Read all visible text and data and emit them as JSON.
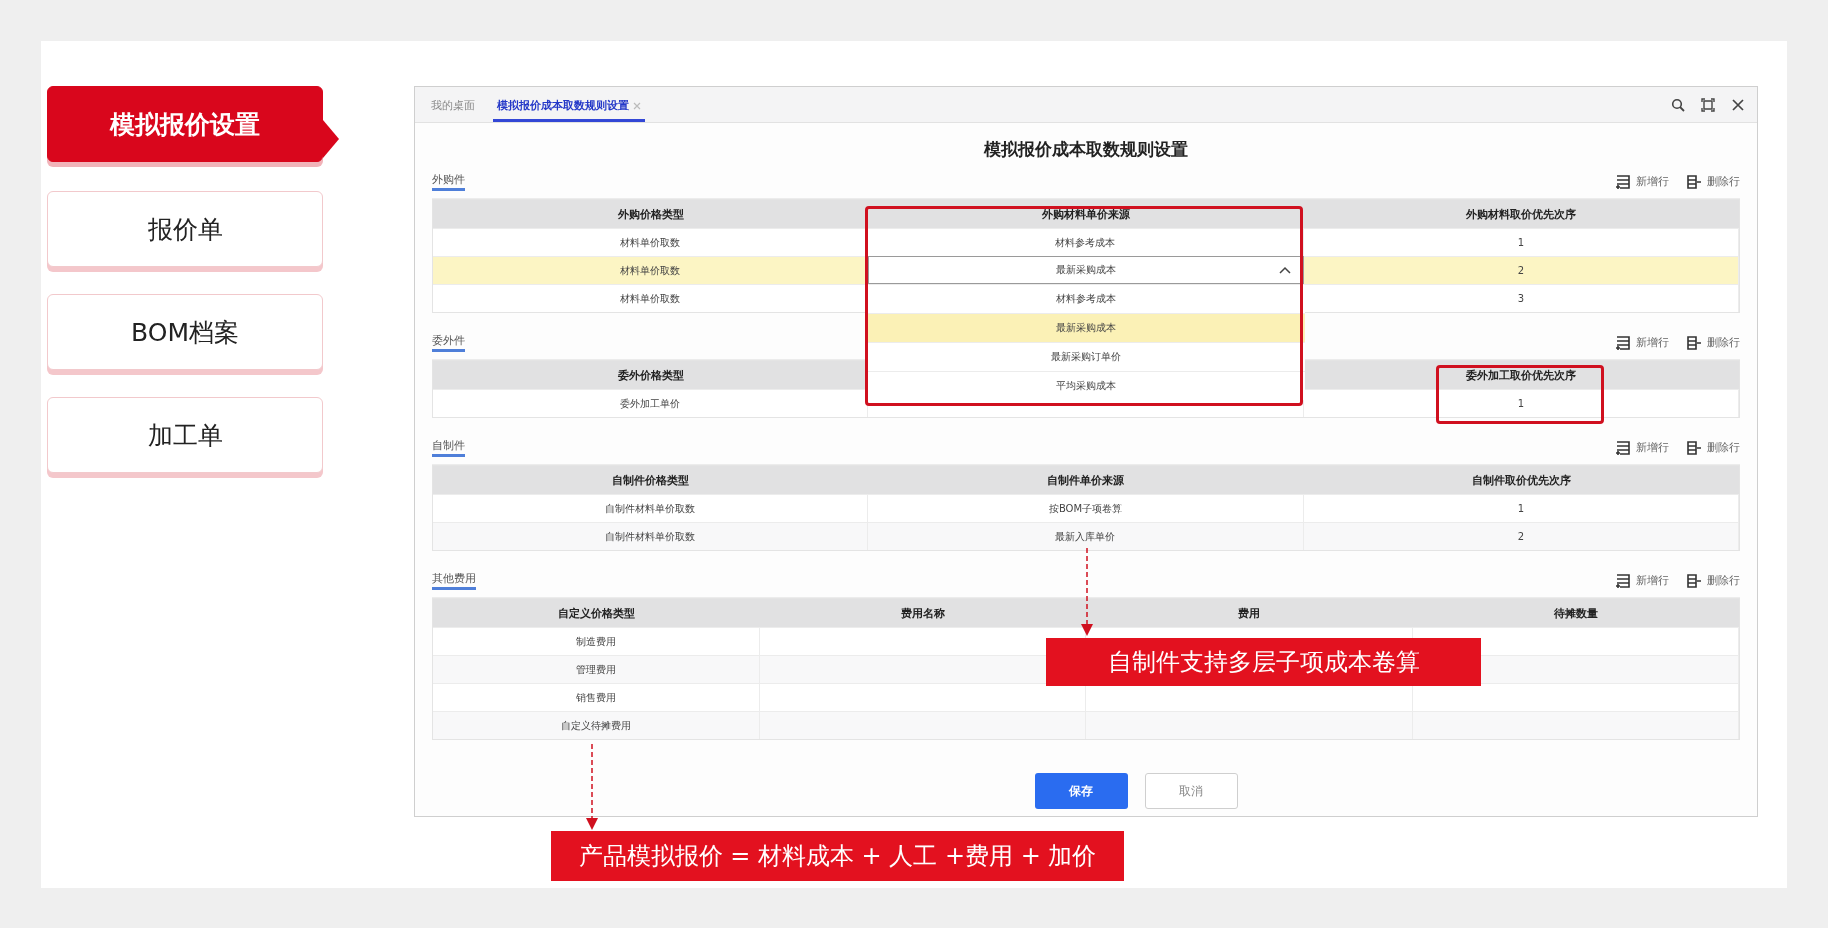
{
  "nav": [
    {
      "label": "模拟报价设置",
      "selected": true
    },
    {
      "label": "报价单",
      "selected": false
    },
    {
      "label": "BOM档案",
      "selected": false
    },
    {
      "label": "加工单",
      "selected": false
    }
  ],
  "window": {
    "tabs": [
      {
        "label": "我的桌面",
        "selected": false,
        "closable": false
      },
      {
        "label": "模拟报价成本取数规则设置",
        "selected": true,
        "closable": true
      }
    ],
    "title": "模拟报价成本取数规则设置",
    "sections": [
      {
        "name": "外购件",
        "actions": [
          {
            "label": "新增行",
            "kind": "add"
          },
          {
            "label": "删除行",
            "kind": "delete"
          }
        ],
        "columns": [
          "外购价格类型",
          "外购材料单价来源",
          "外购材料取价优先次序"
        ],
        "rows": [
          {
            "selected": false,
            "cells": [
              "材料单价取数",
              "材料参考成本",
              "1"
            ]
          },
          {
            "selected": true,
            "cells": [
              "材料单价取数",
              {
                "value": "最新采购成本",
                "open": true,
                "options": [
                  {
                    "label": "材料参考成本",
                    "selected": false
                  },
                  {
                    "label": "最新采购成本",
                    "selected": true
                  },
                  {
                    "label": "最新采购订单价",
                    "selected": false
                  },
                  {
                    "label": "平均采购成本",
                    "selected": false
                  }
                ]
              },
              "2"
            ]
          },
          {
            "selected": false,
            "cells": [
              "材料单价取数",
              null,
              "3"
            ]
          }
        ]
      },
      {
        "name": "委外件",
        "actions": [
          {
            "label": "新增行",
            "kind": "add"
          },
          {
            "label": "删除行",
            "kind": "delete"
          }
        ],
        "columns": [
          "委外价格类型",
          null,
          "委外加工取价优先次序"
        ],
        "rows": [
          {
            "selected": false,
            "cells": [
              "委外加工单价",
              null,
              "1"
            ]
          }
        ]
      },
      {
        "name": "自制件",
        "actions": [
          {
            "label": "新增行",
            "kind": "add"
          },
          {
            "label": "删除行",
            "kind": "delete"
          }
        ],
        "columns": [
          "自制件价格类型",
          "自制件单价来源",
          "自制件取价优先次序"
        ],
        "rows": [
          {
            "selected": false,
            "cells": [
              "自制件材料单价取数",
              "按BOM子项卷算",
              "1"
            ]
          },
          {
            "selected": false,
            "cells": [
              "自制件材料单价取数",
              "最新入库单价",
              "2"
            ]
          }
        ]
      },
      {
        "name": "其他费用",
        "actions": [
          {
            "label": "新增行",
            "kind": "add"
          },
          {
            "label": "删除行",
            "kind": "delete"
          }
        ],
        "columns": [
          "自定义价格类型",
          "费用名称",
          "费用",
          "待摊数量"
        ],
        "rows": [
          {
            "selected": false,
            "cells": [
              "制造费用",
              null,
              null,
              null
            ]
          },
          {
            "selected": false,
            "cells": [
              "管理费用",
              null,
              null,
              null
            ]
          },
          {
            "selected": false,
            "cells": [
              "销售费用",
              null,
              null,
              null
            ]
          },
          {
            "selected": false,
            "cells": [
              "自定义待摊费用",
              null,
              null,
              null
            ]
          }
        ]
      }
    ],
    "buttons": [
      {
        "label": "保存",
        "kind": "primary"
      },
      {
        "label": "取消",
        "kind": "secondary"
      }
    ]
  },
  "callouts": [
    {
      "text": "自制件支持多层子项成本卷算"
    },
    {
      "text": "产品模拟报价 = 材料成本 + 人工 +费用 + 加价"
    }
  ]
}
